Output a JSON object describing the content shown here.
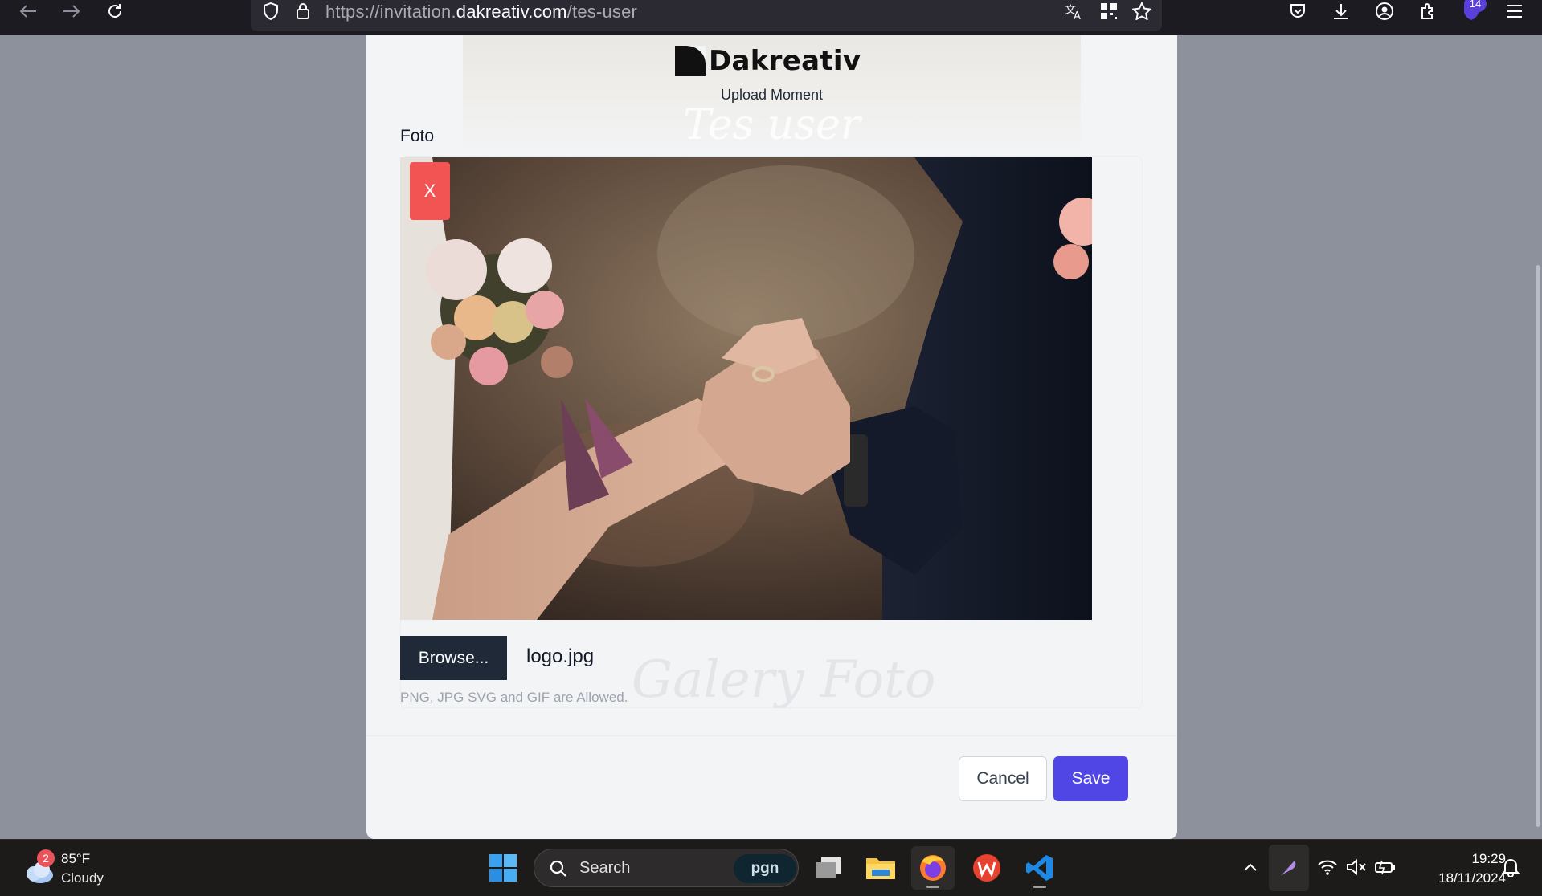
{
  "browser": {
    "url_prefix": "https://invitation.",
    "url_domain": "dakreativ.com",
    "url_path": "/tes-user",
    "extension_badge": "14"
  },
  "modal": {
    "brand": "Dakreativ",
    "subtitle": "Upload Moment",
    "hero_script": "Tes user",
    "field_label": "Foto",
    "remove_label": "X",
    "browse_label": "Browse...",
    "file_name": "logo.jpg",
    "hint": "PNG, JPG SVG and GIF are Allowed.",
    "watermark": "Galery Foto",
    "cancel_label": "Cancel",
    "save_label": "Save",
    "accent_color": "#4f46e5",
    "danger_color": "#f25454"
  },
  "taskbar": {
    "weather_temp": "85°F",
    "weather_condition": "Cloudy",
    "weather_badge": "2",
    "search_label": "Search",
    "search_promo": "pgn",
    "time": "19:29",
    "date": "18/11/2024"
  }
}
